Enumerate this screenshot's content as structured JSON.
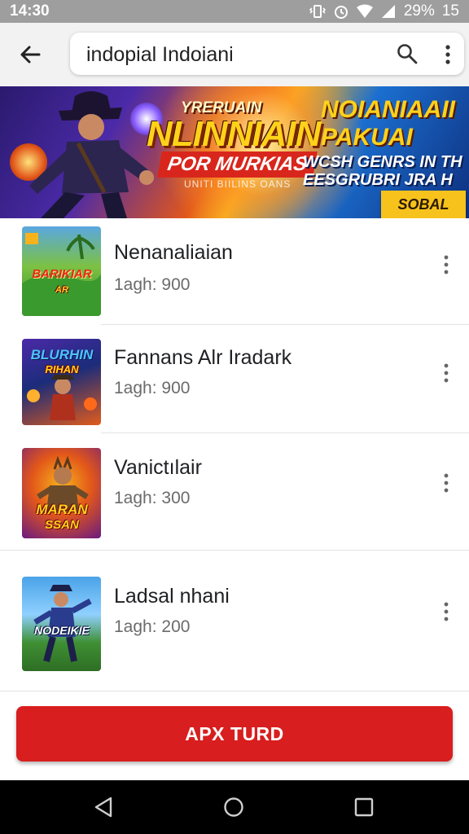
{
  "status_bar": {
    "time": "14:30",
    "battery": "29%",
    "notification_count": "15",
    "icons": [
      "vibrate-icon",
      "alarm-icon",
      "wifi-icon",
      "signal-icon"
    ]
  },
  "search": {
    "query": "indopial Indoiani",
    "back_icon": "arrow-left-icon",
    "search_icon": "search-icon",
    "more_icon": "more-vert-icon"
  },
  "banner": {
    "kicker": "YRERUAIN",
    "title": "NLINNIAIN",
    "subtitle": "POR MURKIAS",
    "tagline": "UNITI BIILINS OANS",
    "right_title": "NOIANIAAII PAKUAI",
    "right_sub": "WCSH GENRS IN TH EESGRUBRI JRA H",
    "cta": "SOBAL"
  },
  "apps": [
    {
      "name": "Nenanaliaian",
      "meta": "1agh: 900",
      "thumb_text": "BARIKIAR",
      "thumb_sub": "AR",
      "colors": [
        "#7cc142",
        "#2f8a2a",
        "#5aa7e0"
      ]
    },
    {
      "name": "Fannans Alr Iradark",
      "meta": "1agh: 900",
      "thumb_text": "BLURHIN",
      "thumb_sub": "RIHAN",
      "colors": [
        "#4b2aa8",
        "#e25b1a",
        "#1b2c7a"
      ]
    },
    {
      "name": "Vanictılair",
      "meta": "1agh: 300",
      "thumb_text": "MARAN",
      "thumb_sub": "SSAN",
      "colors": [
        "#e2571a",
        "#6b1a80",
        "#f7b21c"
      ]
    },
    {
      "name": "Ladsal nhani",
      "meta": "1agh: 200",
      "thumb_text": "NODEIKIE",
      "thumb_sub": "",
      "colors": [
        "#4aa3e8",
        "#3f8f34",
        "#2a3c8e"
      ]
    }
  ],
  "cta_button": {
    "label": "APX TURD",
    "color": "#d81e1e"
  },
  "nav": {
    "back": "nav-back-icon",
    "home": "nav-home-icon",
    "recents": "nav-recents-icon"
  }
}
